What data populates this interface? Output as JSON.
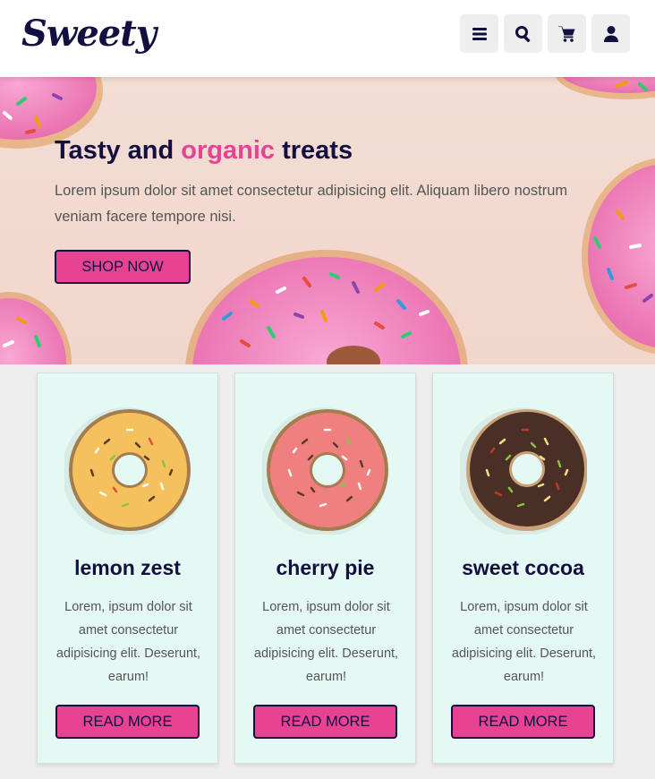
{
  "brand": {
    "logo": "Sweety"
  },
  "header": {
    "icons": [
      "menu-icon",
      "search-icon",
      "cart-icon",
      "user-icon"
    ]
  },
  "hero": {
    "title_before": "Tasty and ",
    "title_accent": "organic",
    "title_after": " treats",
    "text": "Lorem ipsum dolor sit amet consectetur adipisicing elit. Aliquam libero nostrum veniam facere tempore nisi.",
    "button": "SHOP NOW"
  },
  "colors": {
    "accent": "#e84393",
    "dark": "#130f40",
    "card_bg": "#e5f9f4"
  },
  "products": [
    {
      "name": "lemon zest",
      "text": "Lorem, ipsum dolor sit amet consectetur adipisicing elit. Deserunt, earum!",
      "button": "READ MORE",
      "icing": "#f5c15c"
    },
    {
      "name": "cherry pie",
      "text": "Lorem, ipsum dolor sit amet consectetur adipisicing elit. Deserunt, earum!",
      "button": "READ MORE",
      "icing": "#f08080"
    },
    {
      "name": "sweet cocoa",
      "text": "Lorem, ipsum dolor sit amet consectetur adipisicing elit. Deserunt, earum!",
      "button": "READ MORE",
      "icing": "#4a2f27"
    }
  ]
}
